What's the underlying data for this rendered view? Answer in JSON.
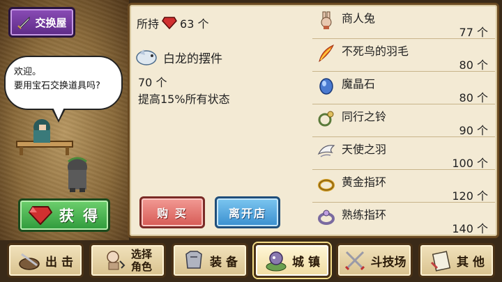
{
  "shop": {
    "title": "交换屋"
  },
  "npc": {
    "greeting_line1": "欢迎。",
    "greeting_line2": "要用宝石交换道具吗?"
  },
  "get_button": {
    "label": "获 得"
  },
  "owned": {
    "label": "所持",
    "value": "63 个"
  },
  "selected_item": {
    "name": "白龙的摆件",
    "price": "70 个",
    "description": "提高15%所有状态"
  },
  "buttons": {
    "buy": "购 买",
    "leave": "离开店"
  },
  "items": [
    {
      "name": "商人兔",
      "price": "77 个",
      "icon": "rabbit-icon"
    },
    {
      "name": "不死鸟的羽毛",
      "price": "80 个",
      "icon": "phoenix-feather-icon"
    },
    {
      "name": "魔晶石",
      "price": "80 个",
      "icon": "magic-crystal-icon"
    },
    {
      "name": "同行之铃",
      "price": "90 个",
      "icon": "bell-icon"
    },
    {
      "name": "天使之羽",
      "price": "100 个",
      "icon": "angel-wing-icon"
    },
    {
      "name": "黄金指环",
      "price": "120 个",
      "icon": "gold-ring-icon"
    },
    {
      "name": "熟练指环",
      "price": "140 个",
      "icon": "skill-ring-icon"
    }
  ],
  "nav": [
    {
      "label": "出 击",
      "icon": "sortie-icon"
    },
    {
      "label_line1": "选择",
      "label_line2": "角色",
      "icon": "character-select-icon"
    },
    {
      "label": "装 备",
      "icon": "armor-icon"
    },
    {
      "label": "城 镇",
      "icon": "town-icon",
      "active": true
    },
    {
      "label": "斗技场",
      "icon": "arena-icon"
    },
    {
      "label": "其 他",
      "icon": "other-icon"
    }
  ],
  "colors": {
    "panel_bg": "#f3ead4",
    "shop_badge": "#6d33a0",
    "get_button": "#3fae45",
    "buy_button": "#e07a74",
    "leave_button": "#4aa0dc"
  }
}
